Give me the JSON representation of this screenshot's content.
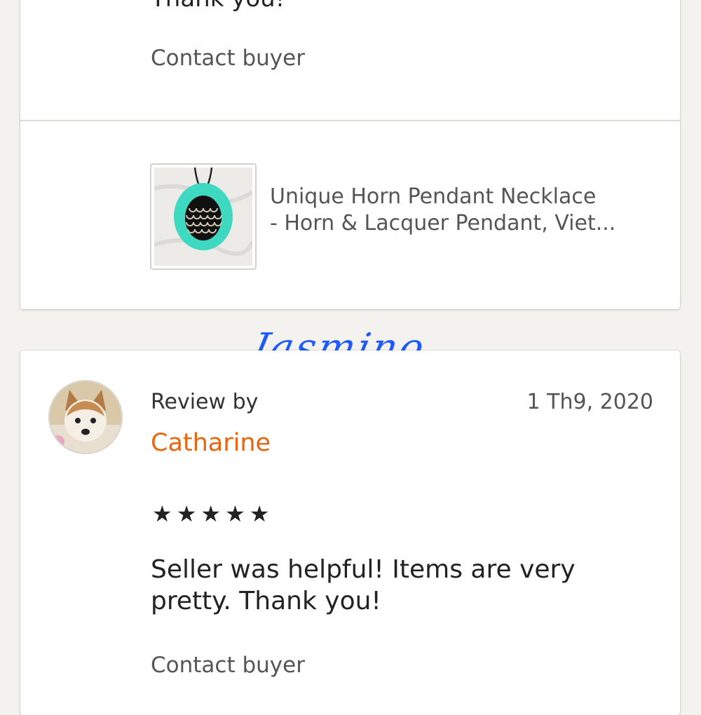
{
  "review_top": {
    "partial_text": "Thank you!",
    "contact_label": "Contact buyer",
    "listing": {
      "title_line1": "Unique Horn Pendant Necklace",
      "title_line2": "- Horn & Lacquer Pendant, Viet..."
    }
  },
  "watermark": "Jasmino",
  "review_bottom": {
    "review_by_label": "Review by",
    "date": "1 Th9, 2020",
    "reviewer_name": "Catharine",
    "rating": 5,
    "stars": "★★★★★",
    "text": "Seller was helpful! Items are very pretty. Thank you!",
    "contact_label": "Contact buyer"
  },
  "colors": {
    "background": "#f3f2ee",
    "reviewer_name": "#e8650e",
    "watermark": "#1e5bff",
    "pendant": "#3fd9c2"
  }
}
